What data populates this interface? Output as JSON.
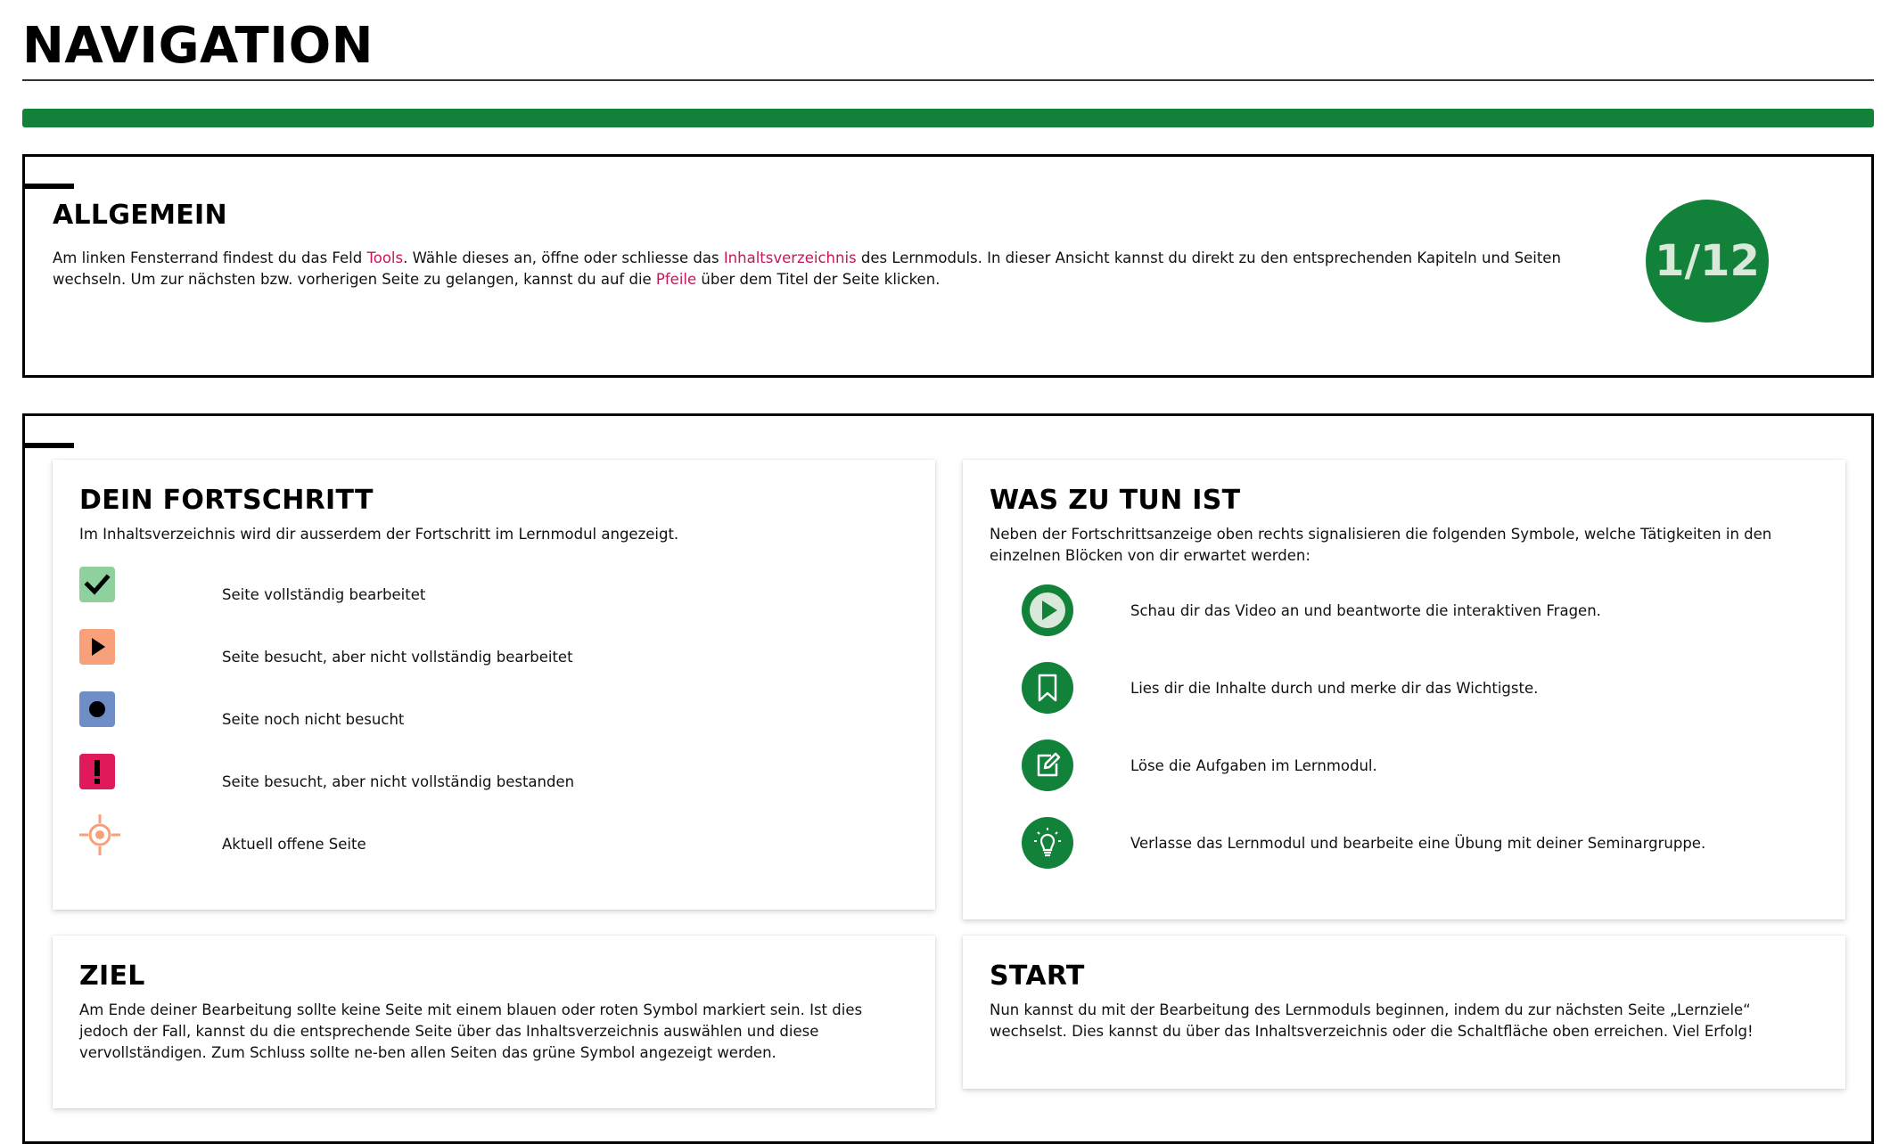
{
  "page": {
    "title": "NAVIGATION",
    "progress_fraction": 0.0833
  },
  "general": {
    "heading": "ALLGEMEIN",
    "text_1": "Am linken Fensterrand findest du das Feld ",
    "link_tools": "Tools",
    "text_2": ". Wähle dieses an, öffne oder schliesse das ",
    "link_toc": "Inhaltsverzeichnis",
    "text_3": " des Lernmoduls. In dieser Ansicht kannst du direkt zu den entsprechenden Kapiteln und Seiten wechseln. Um zur nächsten bzw. vorherigen Seite zu gelangen, kannst du auf die ",
    "link_arrows": "Pfeile",
    "text_4": " über dem Titel der Seite klicken.",
    "page_counter": "1/12"
  },
  "progress_card": {
    "heading": "DEIN FORTSCHRITT",
    "intro": "Im Inhaltsverzeichnis wird dir ausserdem der Fortschritt im Lernmodul angezeigt.",
    "items": [
      {
        "icon": "checkmark-icon",
        "color": "#8fd19e",
        "label": "Seite vollständig bearbeitet"
      },
      {
        "icon": "play-icon",
        "color": "#f8a07a",
        "label": "Seite besucht, aber nicht vollständig bearbeitet"
      },
      {
        "icon": "dot-icon",
        "color": "#6f8ec7",
        "label": "Seite noch nicht besucht"
      },
      {
        "icon": "exclamation-icon",
        "color": "#e0195a",
        "label": "Seite besucht, aber nicht vollständig bestanden"
      },
      {
        "icon": "crosshair-icon",
        "color": "#f8a07a",
        "label": "Aktuell offene Seite"
      }
    ]
  },
  "todo_card": {
    "heading": "WAS ZU TUN IST",
    "intro": "Neben der Fortschrittsanzeige oben rechts signalisieren die folgenden Symbole, welche Tätigkeiten in den einzelnen Blöcken von dir erwartet werden:",
    "items": [
      {
        "icon": "play-circle-icon",
        "label": "Schau dir das Video an und beantworte die interaktiven Fragen."
      },
      {
        "icon": "bookmark-icon",
        "label": "Lies dir die Inhalte durch und merke dir das Wichtigste."
      },
      {
        "icon": "edit-icon",
        "label": "Löse die Aufgaben im Lernmodul."
      },
      {
        "icon": "lightbulb-icon",
        "label": "Verlasse das Lernmodul und bearbeite eine Übung mit deiner Seminargruppe."
      }
    ]
  },
  "goal_card": {
    "heading": "ZIEL",
    "text": "Am Ende deiner Bearbeitung sollte keine Seite mit einem blauen oder roten Symbol markiert sein. Ist dies jedoch der Fall, kannst du die entsprechende Seite über das Inhaltsverzeichnis auswählen und diese vervollständigen. Zum Schluss sollte ne-ben allen Seiten das grüne Symbol angezeigt werden."
  },
  "start_card": {
    "heading": "START",
    "text": "Nun kannst du mit der Bearbeitung des Lernmoduls beginnen, indem du zur nächsten Seite „Lernziele“ wechselst. Dies kannst du über das Inhaltsverzeichnis oder die Schaltfläche oben erreichen. Viel Erfolg!"
  },
  "colors": {
    "brand_green": "#12823b",
    "link_pink": "#c2185b"
  }
}
